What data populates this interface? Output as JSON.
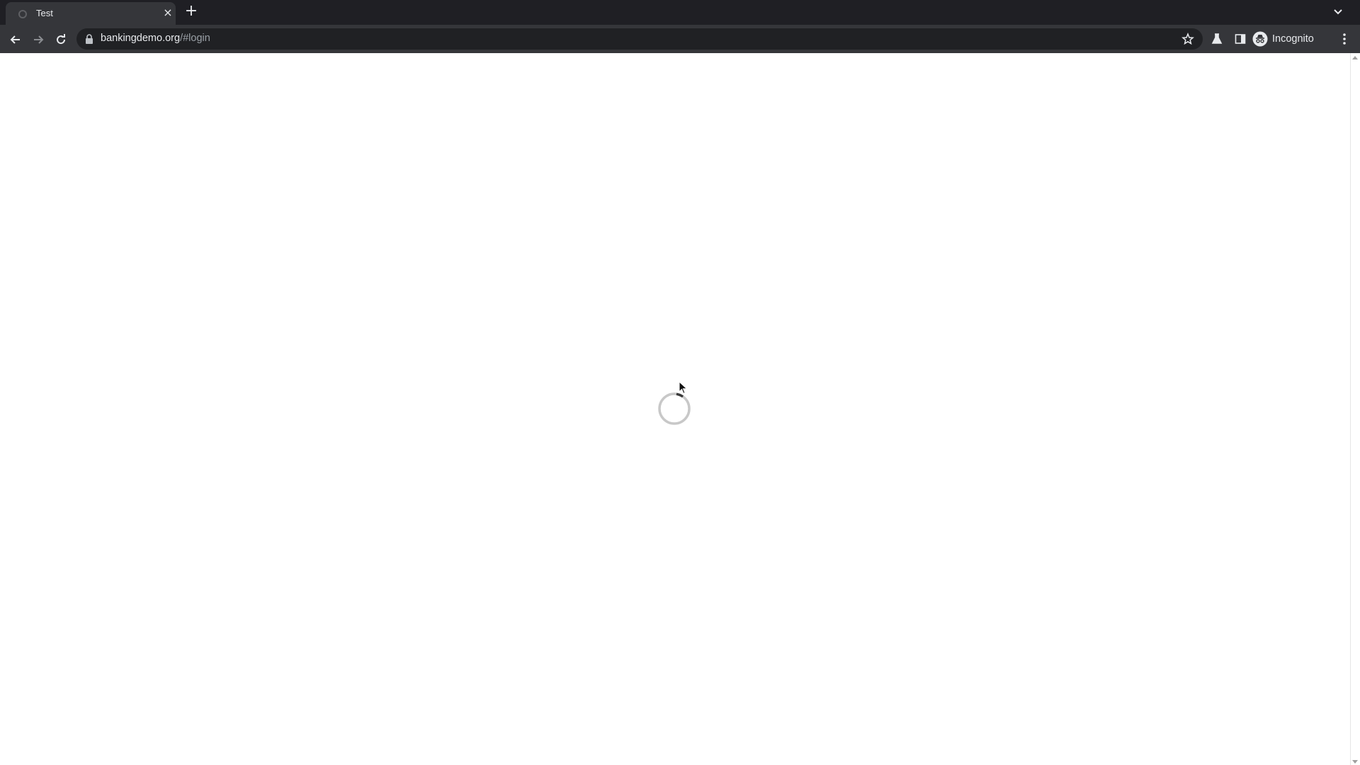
{
  "tab": {
    "title": "Test",
    "close_icon": "close-icon",
    "new_tab_icon": "plus-icon"
  },
  "toolbar": {
    "url_host": "bankingdemo.org",
    "url_path": "/#login",
    "profile_label": "Incognito"
  },
  "page": {
    "state": "loading",
    "spinner_icon": "loading-spinner-icon"
  },
  "colors": {
    "tabstrip": "#1f1f24",
    "toolbar": "#35363a",
    "omnibox": "#202124",
    "text": "#e8eaed",
    "spinner": "#c8c8c8"
  }
}
